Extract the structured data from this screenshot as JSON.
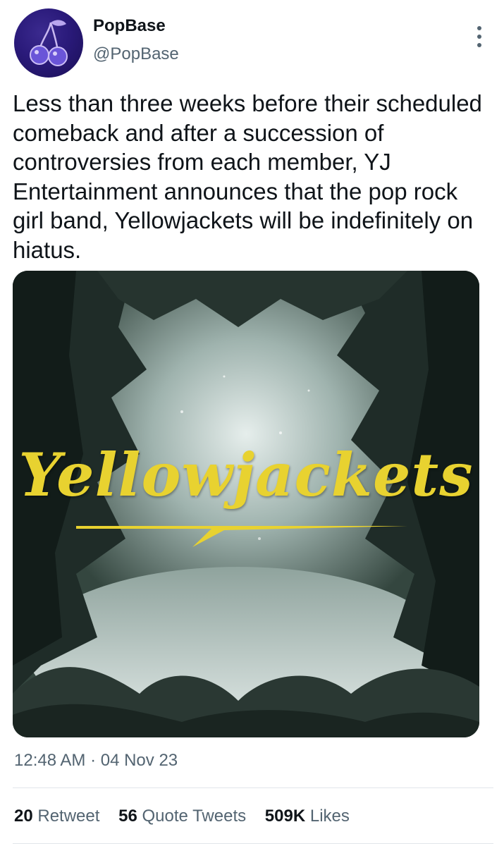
{
  "author": {
    "display_name": "PopBase",
    "handle": "@PopBase",
    "avatar_icon": "cherry-icon"
  },
  "tweet": {
    "text": "Less than three weeks before their scheduled comeback and after a succession of controversies from each member, YJ Entertainment announces that the pop rock girl band, Yellowjackets will be indefinitely on hiatus.",
    "timestamp": "12:48 AM · 04 Nov 23"
  },
  "media": {
    "logo_text": "Yellowjackets",
    "logo_color": "#e8d230"
  },
  "stats": {
    "retweets_count": "20",
    "retweets_label": "Retweet",
    "quotes_count": "56",
    "quotes_label": "Quote Tweets",
    "likes_count": "509K",
    "likes_label": "Likes"
  },
  "colors": {
    "text_primary": "#0f1419",
    "text_secondary": "#536471",
    "divider": "#e1e6ea"
  }
}
